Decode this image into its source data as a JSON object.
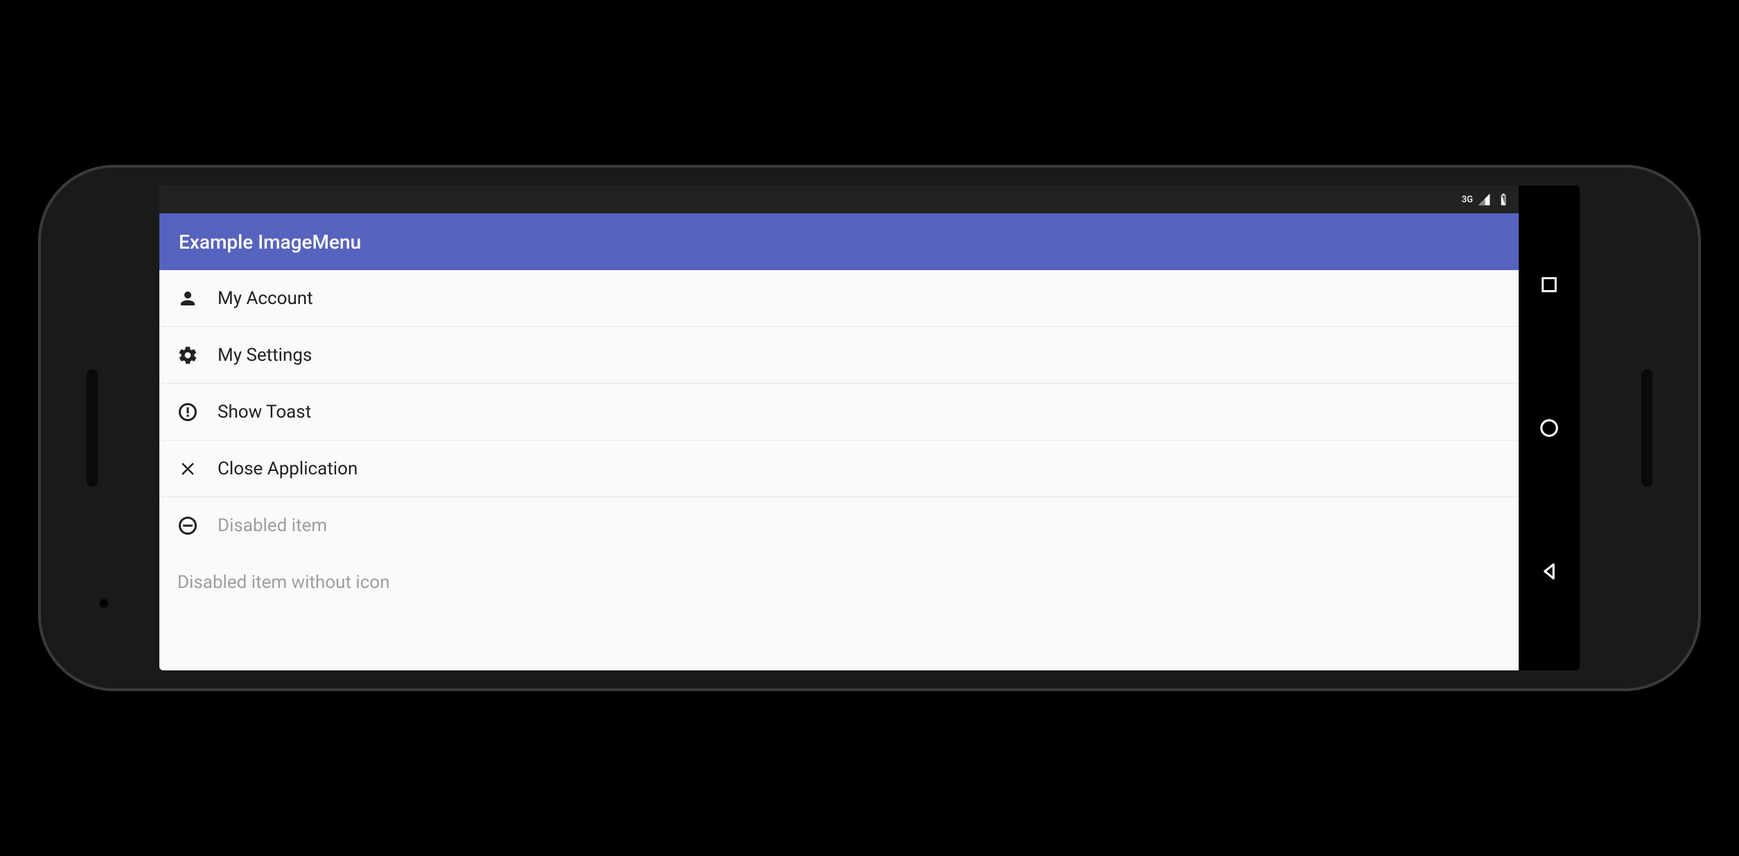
{
  "statusbar": {
    "network_label": "3G"
  },
  "appbar": {
    "title": "Example ImageMenu"
  },
  "menu": {
    "items": [
      {
        "label": "My Account",
        "icon": "person",
        "enabled": true
      },
      {
        "label": "My Settings",
        "icon": "gear",
        "enabled": true
      },
      {
        "label": "Show Toast",
        "icon": "alert-circle",
        "enabled": true
      },
      {
        "label": "Close Application",
        "icon": "close",
        "enabled": true
      },
      {
        "label": "Disabled item",
        "icon": "minus-circle",
        "enabled": false
      },
      {
        "label": "Disabled item without icon",
        "icon": null,
        "enabled": false
      }
    ]
  },
  "colors": {
    "primary": "#5664c0",
    "text": "#212121",
    "text_disabled": "#9e9e9e",
    "divider": "#e6e6e6",
    "background": "#fafafa"
  }
}
